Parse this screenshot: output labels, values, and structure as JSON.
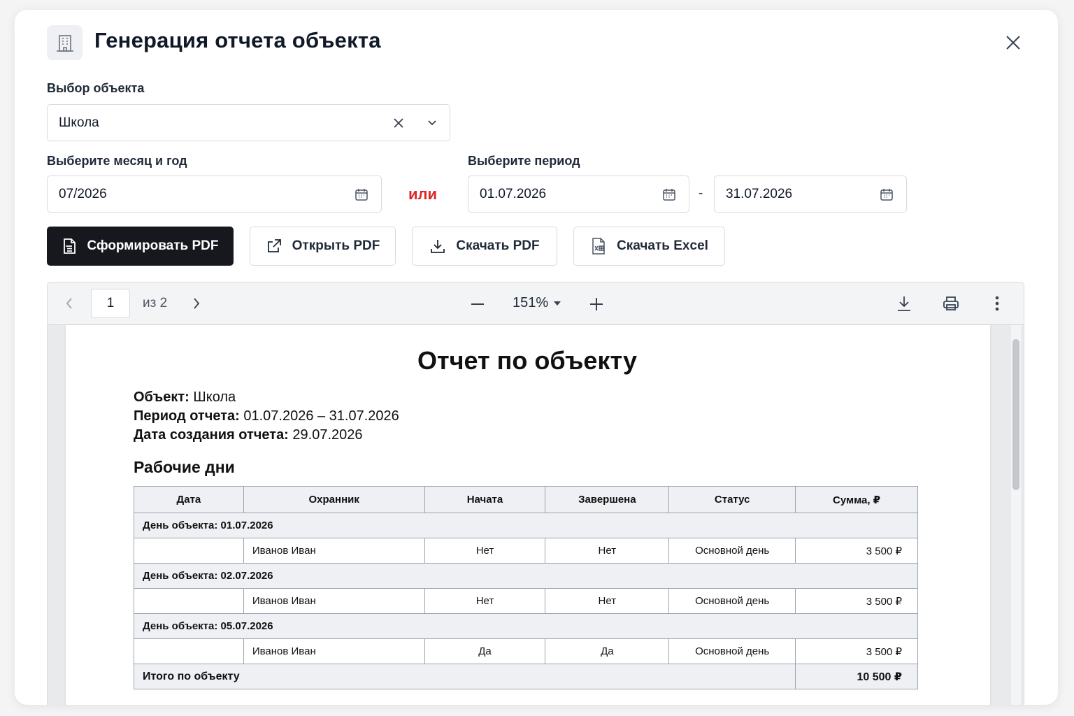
{
  "header": {
    "title": "Генерация отчета объекта",
    "icon": "building-icon"
  },
  "object_select": {
    "label": "Выбор объекта",
    "value": "Школа"
  },
  "month_year": {
    "label": "Выберите месяц и год",
    "value": "07/2026"
  },
  "or_text": "или",
  "period": {
    "label": "Выберите период",
    "from": "01.07.2026",
    "separator": "-",
    "to": "31.07.2026"
  },
  "actions": {
    "generate": "Сформировать PDF",
    "open": "Открыть PDF",
    "download_pdf": "Скачать PDF",
    "download_excel": "Скачать Excel"
  },
  "viewer": {
    "page": "1",
    "of": "из 2",
    "zoom": "151%"
  },
  "report": {
    "title": "Отчет по объекту",
    "object_label": "Объект:",
    "object_value": "Школа",
    "period_label": "Период отчета:",
    "period_value": "01.07.2026 – 31.07.2026",
    "created_label": "Дата создания отчета:",
    "created_value": "29.07.2026",
    "section": "Рабочие дни",
    "columns": [
      "Дата",
      "Охранник",
      "Начата",
      "Завершена",
      "Статус",
      "Сумма, ₽"
    ],
    "groups": [
      {
        "title": "День объекта: 01.07.2026",
        "row": [
          "",
          "Иванов Иван",
          "Нет",
          "Нет",
          "Основной день",
          "3 500 ₽"
        ]
      },
      {
        "title": "День объекта: 02.07.2026",
        "row": [
          "",
          "Иванов Иван",
          "Нет",
          "Нет",
          "Основной день",
          "3 500 ₽"
        ]
      },
      {
        "title": "День объекта: 05.07.2026",
        "row": [
          "",
          "Иванов Иван",
          "Да",
          "Да",
          "Основной день",
          "3 500 ₽"
        ]
      }
    ],
    "total_label": "Итого по объекту",
    "total_value": "10 500 ₽"
  },
  "colors": {
    "primary": "#16181d",
    "accent_or": "#dc2626",
    "border": "#d7dbe0"
  }
}
